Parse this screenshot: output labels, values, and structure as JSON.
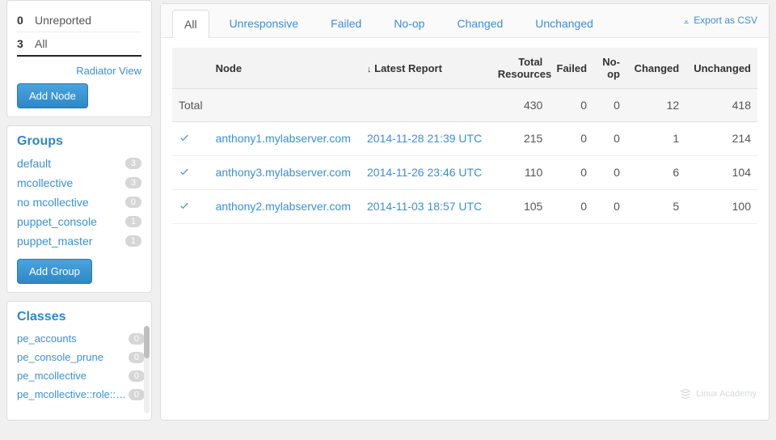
{
  "sidebar": {
    "status": [
      {
        "count": "0",
        "label": "Unreported"
      },
      {
        "count": "3",
        "label": "All"
      }
    ],
    "radiator_label": "Radiator View",
    "add_node_label": "Add Node",
    "groups_title": "Groups",
    "groups": [
      {
        "name": "default",
        "count": "3"
      },
      {
        "name": "mcollective",
        "count": "3"
      },
      {
        "name": "no mcollective",
        "count": "0"
      },
      {
        "name": "puppet_console",
        "count": "1"
      },
      {
        "name": "puppet_master",
        "count": "1"
      }
    ],
    "add_group_label": "Add Group",
    "classes_title": "Classes",
    "classes": [
      {
        "name": "pe_accounts",
        "count": "0"
      },
      {
        "name": "pe_console_prune",
        "count": "0"
      },
      {
        "name": "pe_mcollective",
        "count": "0"
      },
      {
        "name": "pe_mcollective::role::…",
        "count": "0"
      }
    ]
  },
  "tabs": {
    "items": [
      "All",
      "Unresponsive",
      "Failed",
      "No-op",
      "Changed",
      "Unchanged"
    ],
    "active_index": 0
  },
  "export_label": "Export as CSV",
  "columns": {
    "node": "Node",
    "latest": "Latest Report",
    "total_resources": "Total Resources",
    "failed": "Failed",
    "noop": "No-op",
    "changed": "Changed",
    "unchanged": "Unchanged",
    "sort_indicator": "↓"
  },
  "totals": {
    "label": "Total",
    "total_resources": "430",
    "failed": "0",
    "noop": "0",
    "changed": "12",
    "unchanged": "418"
  },
  "rows": [
    {
      "node": "anthony1.mylabserver.com",
      "latest": "2014-11-28 21:39 UTC",
      "total_resources": "215",
      "failed": "0",
      "noop": "0",
      "changed": "1",
      "unchanged": "214"
    },
    {
      "node": "anthony3.mylabserver.com",
      "latest": "2014-11-26 23:46 UTC",
      "total_resources": "110",
      "failed": "0",
      "noop": "0",
      "changed": "6",
      "unchanged": "104"
    },
    {
      "node": "anthony2.mylabserver.com",
      "latest": "2014-11-03 18:57 UTC",
      "total_resources": "105",
      "failed": "0",
      "noop": "0",
      "changed": "5",
      "unchanged": "100"
    }
  ],
  "watermark": "Linux Academy"
}
